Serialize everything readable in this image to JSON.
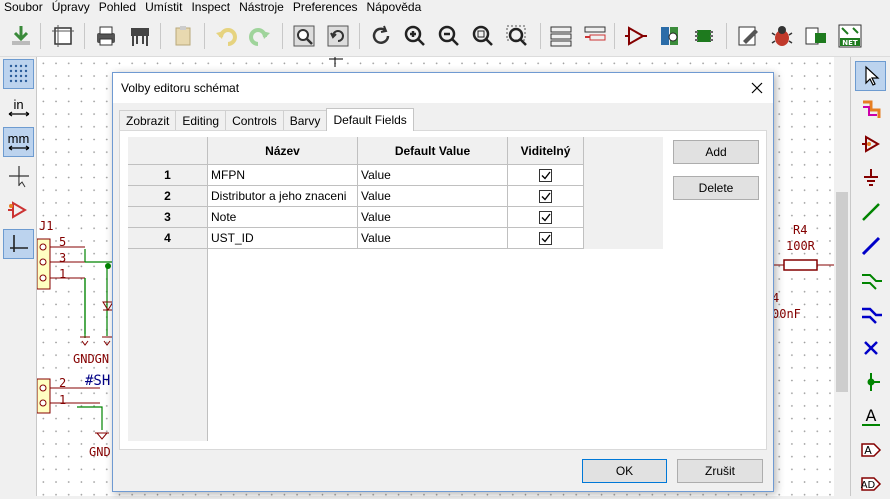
{
  "menu": [
    "Soubor",
    "Úpravy",
    "Pohled",
    "Umístit",
    "Inspect",
    "Nástroje",
    "Preferences",
    "Nápověda"
  ],
  "left_toolbar": {
    "units_in": "in",
    "units_mm": "mm"
  },
  "schematic": {
    "ref_j1": "J1",
    "pin_5": "5",
    "pin_3": "3",
    "pin_1": "1",
    "pin_2": "2",
    "pin_1b": "1",
    "gnd_label": "GNDGN",
    "sh_label": "#SH",
    "gnd_label2": "GND",
    "ref_r4": "R4",
    "val_r4": "100R",
    "cap_ref": "4",
    "cap_val": "00nF"
  },
  "dialog": {
    "title": "Volby editoru schémat",
    "tabs": [
      "Zobrazit",
      "Editing",
      "Controls",
      "Barvy",
      "Default Fields"
    ],
    "active_tab": "Default Fields",
    "grid": {
      "columns": [
        "Název",
        "Default Value",
        "Viditelný"
      ],
      "rows": [
        {
          "num": "1",
          "name": "MFPN",
          "value": "Value",
          "visible": true
        },
        {
          "num": "2",
          "name": "Distributor a jeho znaceni",
          "value": "Value",
          "visible": true
        },
        {
          "num": "3",
          "name": "Note",
          "value": "Value",
          "visible": true
        },
        {
          "num": "4",
          "name": "UST_ID",
          "value": "Value",
          "visible": true
        }
      ]
    },
    "add_label": "Add",
    "delete_label": "Delete",
    "ok_label": "OK",
    "cancel_label": "Zrušit"
  },
  "colors": {
    "selection": "#bcd3ee",
    "accent": "#0078d7",
    "wire": "#008400",
    "component": "#840000"
  }
}
